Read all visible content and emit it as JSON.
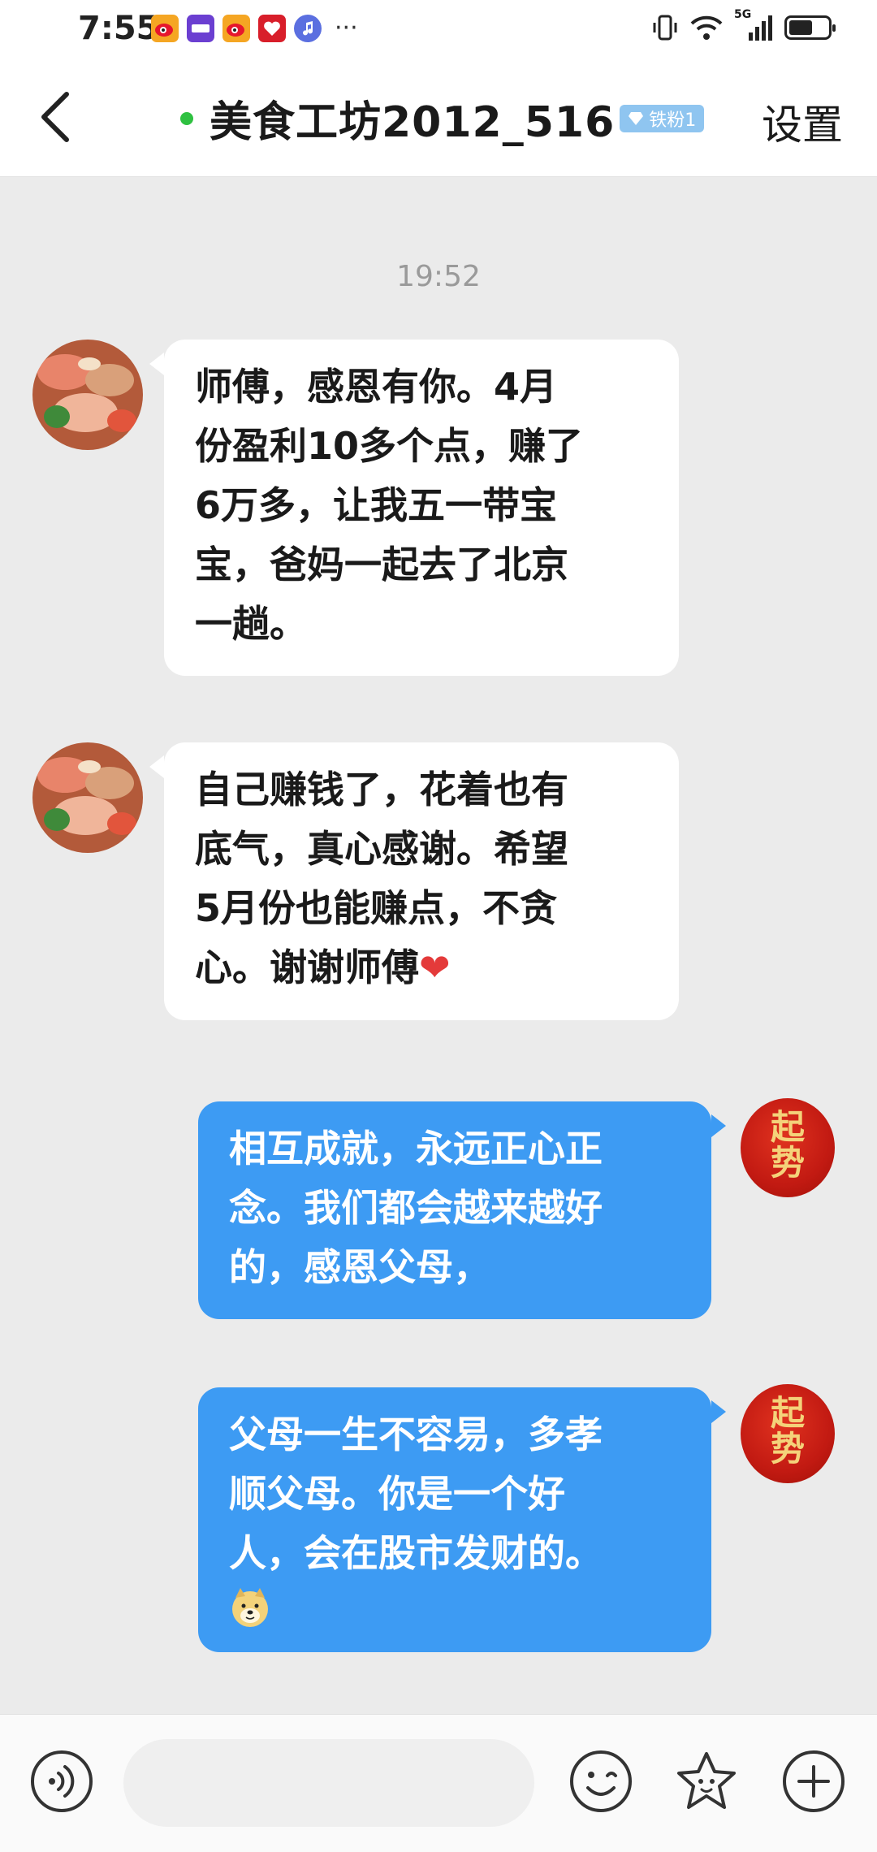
{
  "status_bar": {
    "time": "7:55",
    "app_icons": [
      "weibo-icon",
      "shenpi-icon",
      "weibo-icon",
      "heart-app-icon",
      "music-icon"
    ],
    "more": "···",
    "network": "5G"
  },
  "header": {
    "title": "美食工坊2012_516",
    "badge": "铁粉1",
    "settings_label": "设置"
  },
  "chat": {
    "timestamp": "19:52",
    "messages": [
      {
        "side": "in",
        "lines": [
          "师傅，感恩有你。4月",
          "份盈利10多个点，赚了",
          "6万多，让我五一带宝",
          "宝，爸妈一起去了北京",
          "一趟。"
        ]
      },
      {
        "side": "in",
        "lines": [
          "自己赚钱了，花着也有",
          "底气，真心感谢。希望",
          "5月份也能赚点，不贪",
          "心。谢谢师傅"
        ],
        "emoji": "❤"
      },
      {
        "side": "out",
        "lines": [
          "相互成就，永远正心正",
          "念。我们都会越来越好",
          "的，感恩父母，"
        ]
      },
      {
        "side": "out",
        "lines": [
          "父母一生不容易，多孝",
          "顺父母。你是一个好",
          "人，会在股市发财的。"
        ],
        "emoji": "doge-emoji"
      }
    ],
    "self_avatar_text": [
      "起",
      "势"
    ]
  },
  "colors": {
    "online": "#2fc141",
    "out_bubble": "#3d9bf3",
    "badge": "#8fc5f0",
    "background": "#ebebeb"
  }
}
